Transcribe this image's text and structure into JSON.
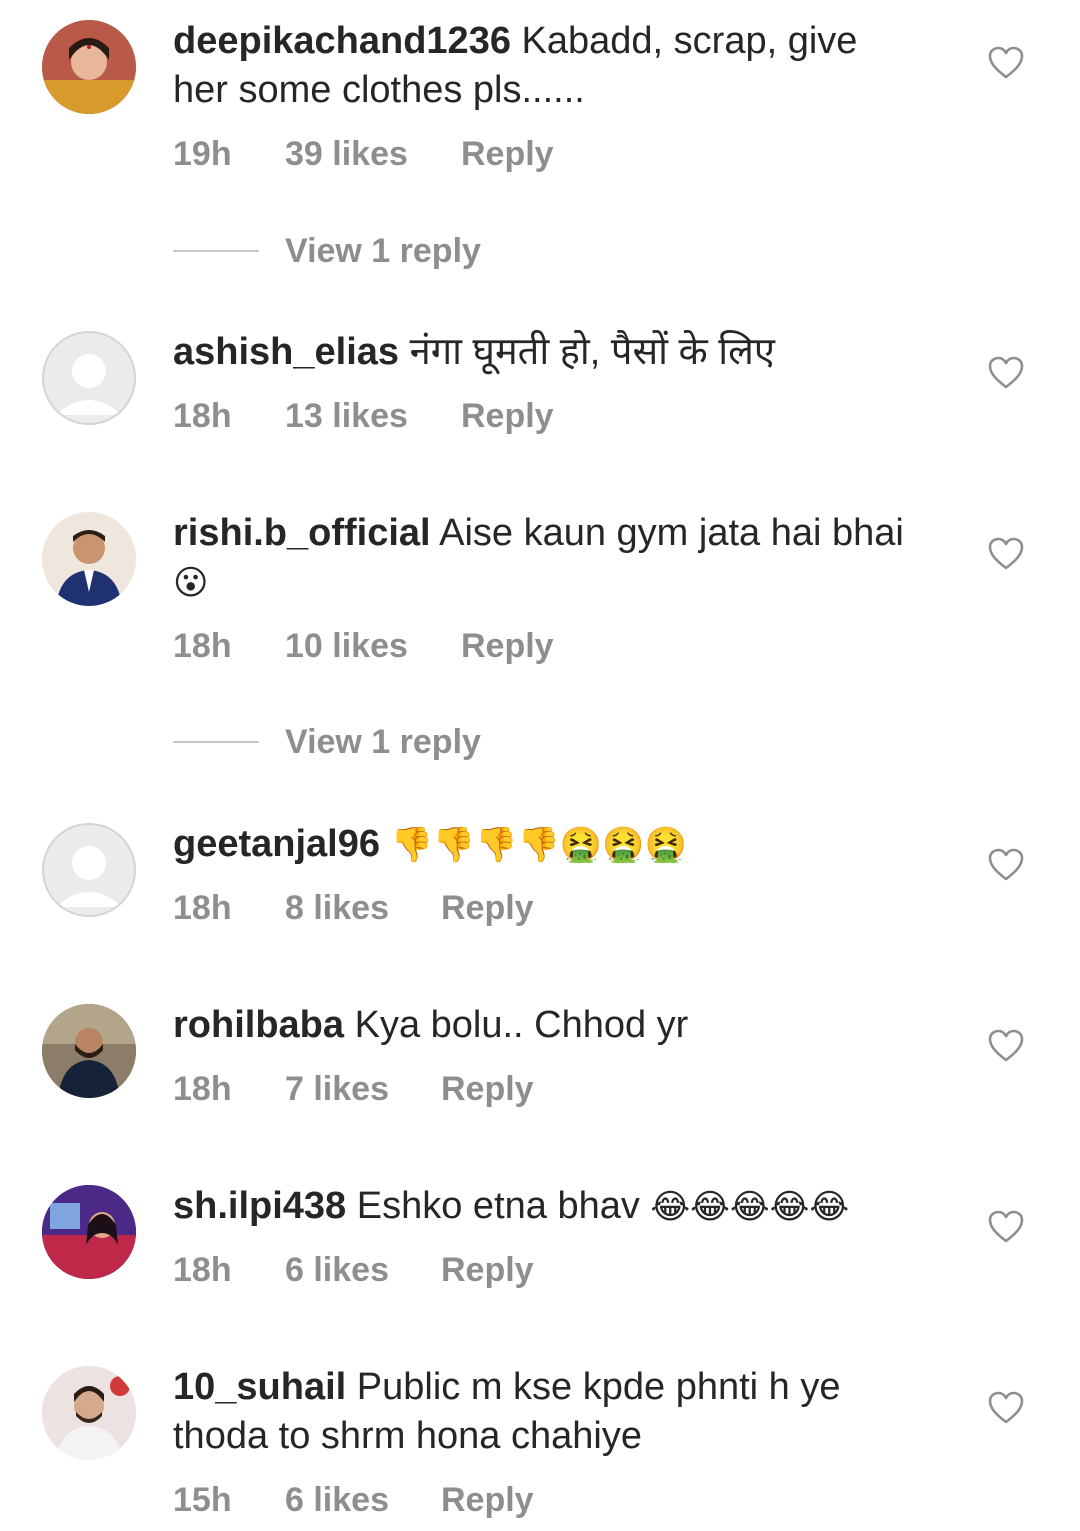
{
  "comments": [
    {
      "username": "deepikachand1236",
      "text": "Kabadd, scrap, give",
      "text_line2": "her some clothes pls......",
      "time": "19h",
      "likes": "39 likes",
      "reply_label": "Reply",
      "avatar": "photo",
      "view_replies": "View 1 reply"
    },
    {
      "username": "ashish_elias",
      "text": "नंगा घूमती हो, पैसों के लिए",
      "time": "18h",
      "likes": "13 likes",
      "reply_label": "Reply",
      "avatar": "default"
    },
    {
      "username": "rishi.b_official",
      "text": "Aise kaun gym jata hai bhai",
      "emoji": "😮",
      "time": "18h",
      "likes": "10 likes",
      "reply_label": "Reply",
      "avatar": "photo",
      "view_replies": "View 1 reply"
    },
    {
      "username": "geetanjal96",
      "emoji": "👎👎👎👎🤮🤮🤮",
      "time": "18h",
      "likes": "8 likes",
      "reply_label": "Reply",
      "avatar": "default"
    },
    {
      "username": "rohilbaba",
      "text": "Kya bolu.. Chhod yr",
      "time": "18h",
      "likes": "7 likes",
      "reply_label": "Reply",
      "avatar": "photo"
    },
    {
      "username": "sh.ilpi438",
      "text": "Eshko etna bhav",
      "emoji": "😂😂😂😂😂",
      "time": "18h",
      "likes": "6 likes",
      "reply_label": "Reply",
      "avatar": "photo"
    },
    {
      "username": "10_suhail",
      "text": "Public m kse kpde phnti h ye",
      "text_line2": "thoda to shrm hona chahiye",
      "time": "15h",
      "likes": "6 likes",
      "reply_label": "Reply",
      "avatar": "photo"
    }
  ],
  "icons": {
    "like": "heart-outline-icon",
    "default_avatar": "person-silhouette-icon"
  },
  "colors": {
    "text": "#262626",
    "secondary": "#8e8e8e",
    "divider": "#c7c7c7",
    "background": "#ffffff"
  }
}
